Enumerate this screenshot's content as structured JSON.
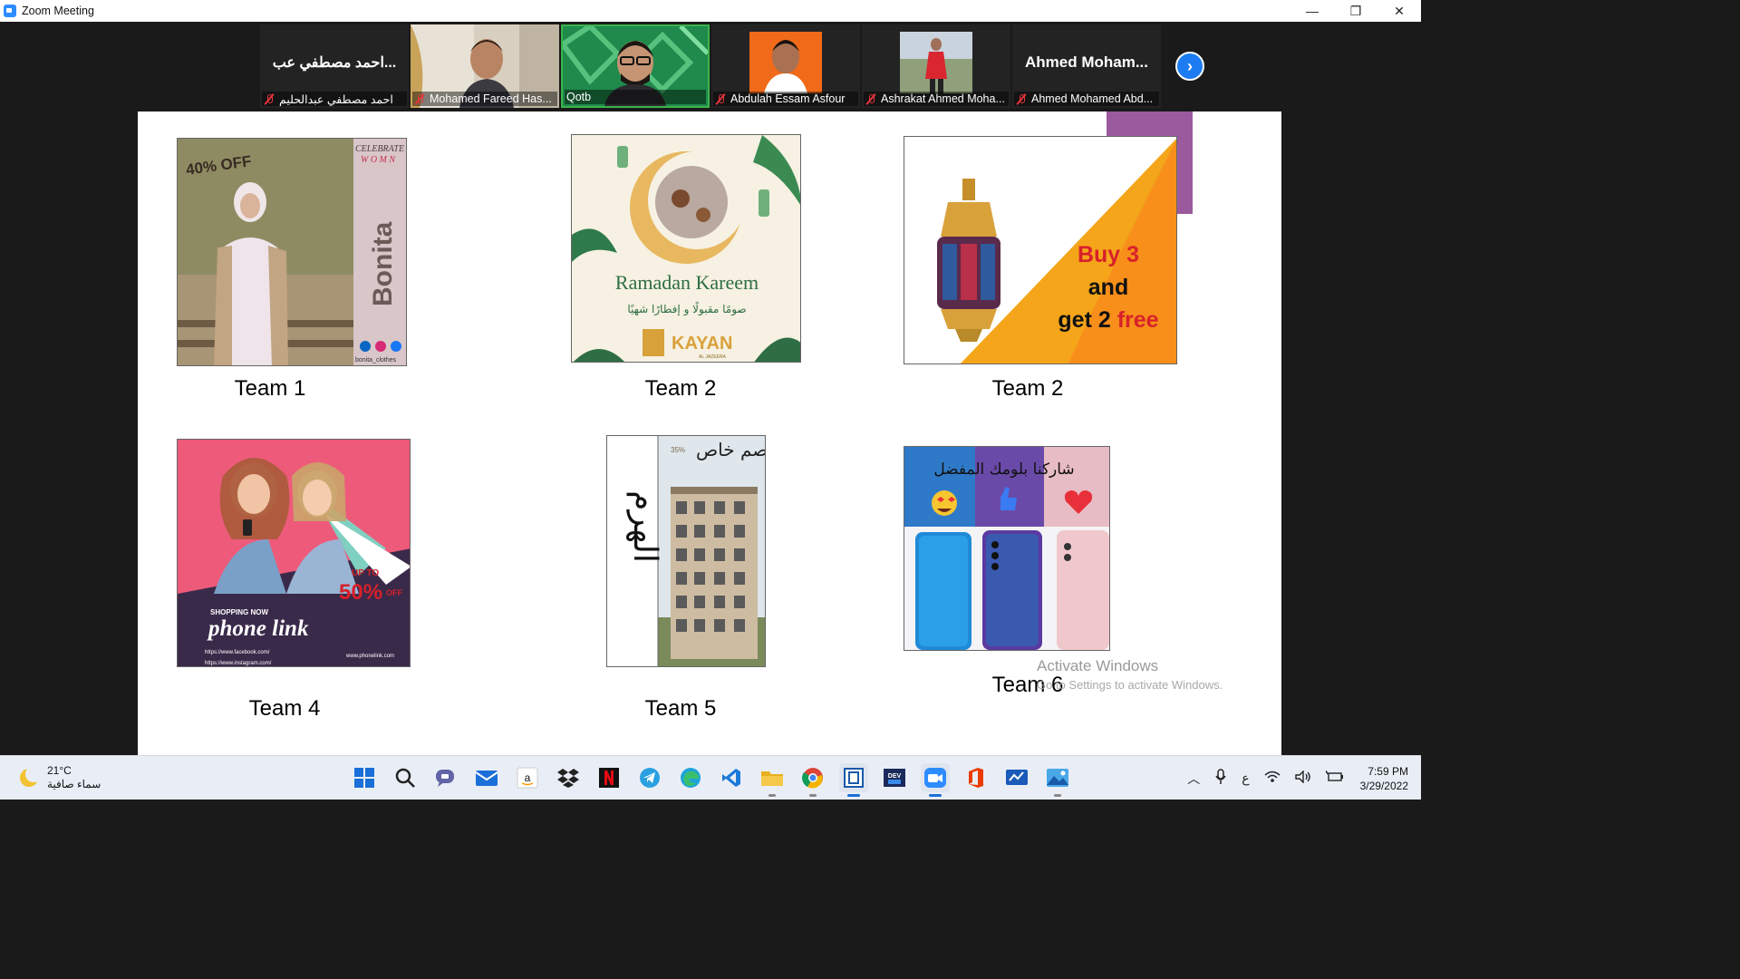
{
  "window": {
    "title": "Zoom Meeting",
    "minimize": "—",
    "restore": "❐",
    "close": "✕"
  },
  "participants": [
    {
      "name": "احمد مصطفي عبدالحليم",
      "display": "احمد مصطفي عب...",
      "video": false
    },
    {
      "name": "Mohamed Fareed Has...",
      "video": true
    },
    {
      "name": "Qotb",
      "video": true,
      "active": true
    },
    {
      "name": "Abdulah Essam Asfour",
      "video": true
    },
    {
      "name": "Ashrakat Ahmed Moha...",
      "video": true
    },
    {
      "name": "Ahmed Mohamed Abd...",
      "display": "Ahmed  Moham...",
      "video": false
    }
  ],
  "slide": {
    "cards": [
      {
        "caption": "Team 1",
        "discount": "40% OFF",
        "tag1": "CELEBRATE",
        "tag2": "W O M N",
        "brand": "Bonita",
        "handle": "bonita_clothes"
      },
      {
        "caption": "Team 2",
        "headline": "Ramadan Kareem",
        "arabic": "صومًا مقبولًا و إفطارًا شهيًا",
        "brand": "KAYAN",
        "subbrand": "AL JAZEERA"
      },
      {
        "caption": "Team 2",
        "line1": "Buy 3",
        "line2": "and",
        "line3a": "get 2 ",
        "line3b": "free"
      },
      {
        "caption": "Team 4",
        "upto": "UP TO",
        "pct": "50%",
        "off": "OFF",
        "shop": "SHOPPING NOW",
        "brand": "phone link",
        "fb": "https://www.facebook.com/",
        "ig": "https://www.instagram.com/",
        "site": "www.phonelink.com"
      },
      {
        "caption": "Team 5",
        "title": "خصم خاص",
        "vertical": "الهرم",
        "pct": "35%"
      },
      {
        "caption": "Team 6",
        "headline": "شاركنا بلومك المفضل"
      }
    ]
  },
  "watermark": {
    "line1": "Activate Windows",
    "line2": "Go to Settings to activate Windows."
  },
  "taskbar": {
    "weather": {
      "temp": "21°C",
      "desc": "سماء صافية"
    },
    "apps": [
      "windows-start",
      "search",
      "teams-chat",
      "mail",
      "amazon",
      "dropbox",
      "netflix",
      "telegram",
      "edge",
      "vscode",
      "file-explorer",
      "chrome",
      "terminal",
      "dev-tool",
      "zoom",
      "office",
      "whiteboard",
      "photos"
    ],
    "tray": {
      "lang": "ع",
      "time": "7:59 PM",
      "date": "3/29/2022"
    }
  }
}
